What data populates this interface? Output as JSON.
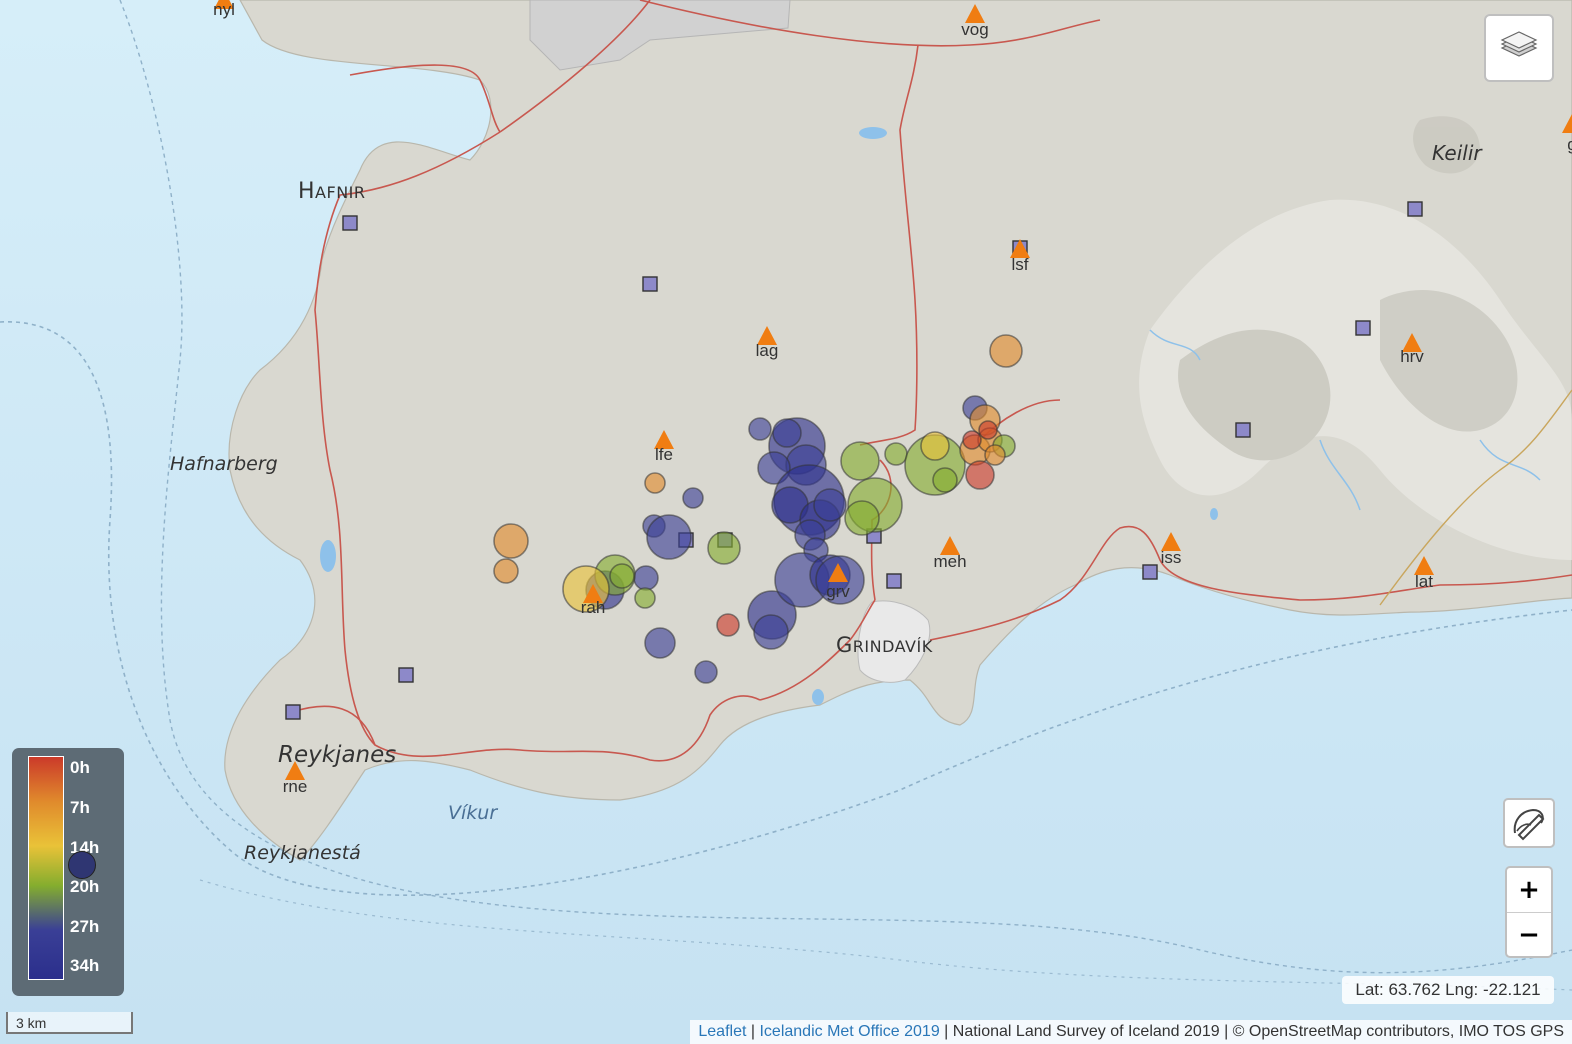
{
  "map": {
    "places": [
      {
        "name": "Hafnir",
        "style": "smallcaps"
      },
      {
        "name": "Grindavík",
        "style": "smallcaps"
      },
      {
        "name": "Keilir",
        "style": "italic"
      },
      {
        "name": "Hafnarberg",
        "style": "italic"
      },
      {
        "name": "Reykjanes",
        "style": "italic"
      },
      {
        "name": "Reykjanestá",
        "style": "italic"
      },
      {
        "name": "Víkur",
        "style": "water"
      }
    ],
    "gps_stations": [
      "nyl",
      "vog",
      "lsf",
      "lag",
      "hrv",
      "lfe",
      "meh",
      "iss",
      "grv",
      "lat",
      "rne",
      "rah",
      "g"
    ],
    "colors": {
      "sea": "#d3ebf8",
      "land": "#d8d7cf",
      "road": "#c8584f",
      "gps_triangle": "#f07d12",
      "seismometer": "#8d89c9",
      "quake_0h": "#cb3a2a",
      "quake_7h": "#e08a2c",
      "quake_14h": "#e9c238",
      "quake_20h": "#84ad2e",
      "quake_27h": "#3a3f96",
      "quake_34h": "#2b2f8c"
    }
  },
  "legend": {
    "title": "",
    "labels": [
      "0h",
      "7h",
      "14h",
      "20h",
      "27h",
      "34h"
    ]
  },
  "controls": {
    "layers_icon": "layers-icon",
    "draw_icon": "draw-polygon-icon",
    "zoom_in": "+",
    "zoom_out": "−"
  },
  "coords": "Lat: 63.762 Lng: -22.121",
  "scale": "3 km",
  "attribution": {
    "leaflet": "Leaflet",
    "sep1": " | ",
    "imo": "Icelandic Met Office 2019",
    "rest": " | National Land Survey of Iceland 2019 | © OpenStreetMap contributors, IMO TOS GPS"
  }
}
